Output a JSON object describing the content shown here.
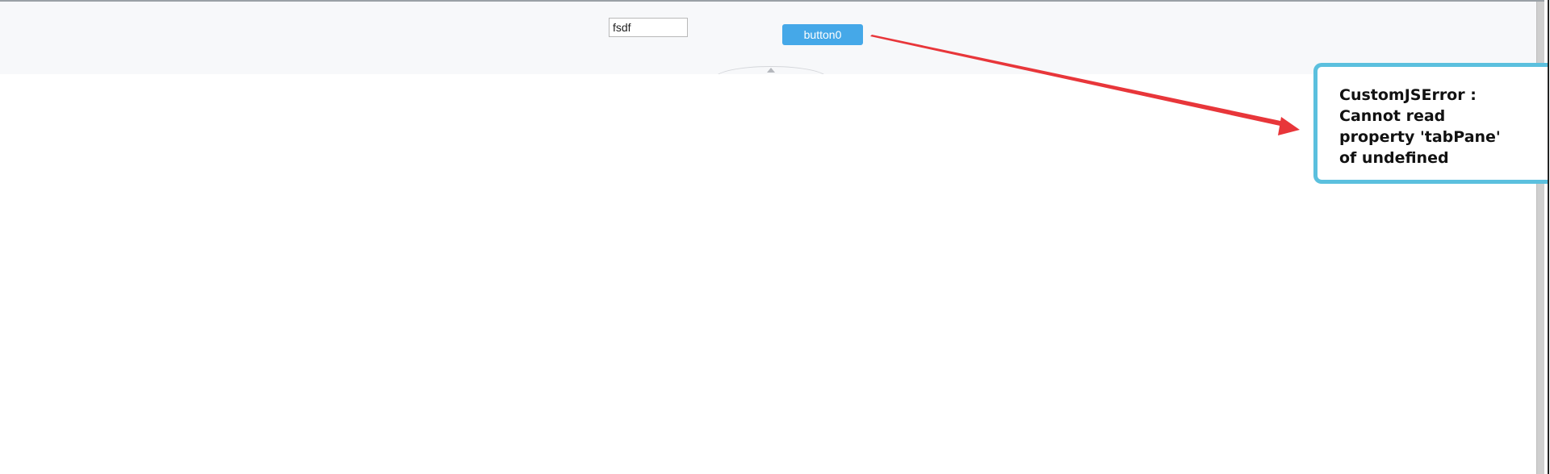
{
  "toolbar": {
    "input_value": "fsdf",
    "button_label": "button0"
  },
  "annotation": {
    "error_message": "CustomJSError : Cannot read property 'tabPane' of undefined",
    "arrow_color": "#e8363a",
    "callout_border_color": "#5bc0de"
  },
  "colors": {
    "button_bg": "#45a8e8",
    "toolbar_bg": "#f7f8fa"
  }
}
